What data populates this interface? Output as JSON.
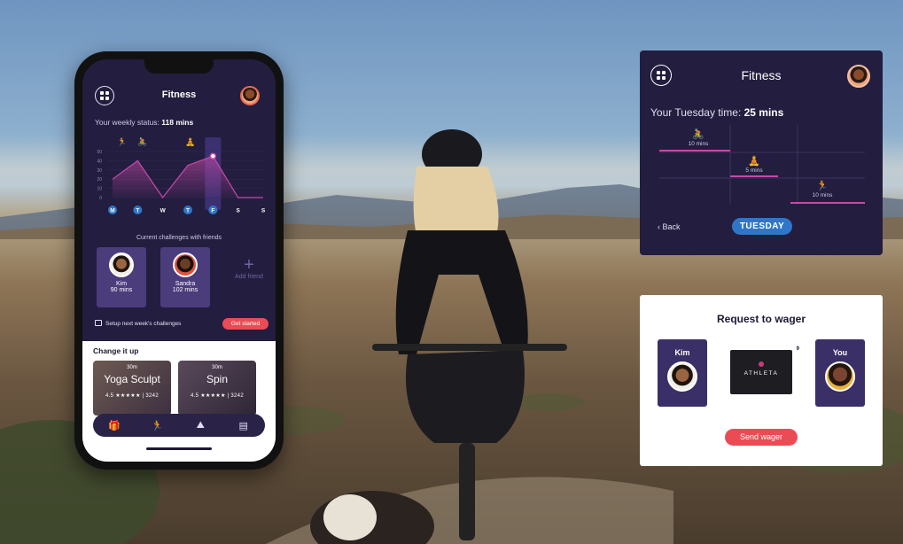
{
  "phone": {
    "title": "Fitness",
    "status_prefix": "Your weekly status: ",
    "status_value": "118 mins",
    "chart_data": {
      "type": "area",
      "categories": [
        "M",
        "T",
        "W",
        "T",
        "F",
        "S",
        "S"
      ],
      "values": [
        20,
        40,
        0,
        35,
        45,
        0,
        0
      ],
      "yticks": [
        "50",
        "40",
        "30",
        "20",
        "10",
        "0"
      ],
      "ylim": [
        0,
        50
      ],
      "highlighted_day": "F",
      "completed_days": [
        "M",
        "T",
        "T",
        "F"
      ]
    },
    "challenges_title": "Current challenges with friends",
    "friends": [
      {
        "name": "Kim",
        "value": "90 mins"
      },
      {
        "name": "Sandra",
        "value": "102 mins"
      }
    ],
    "add_friend_label": "Add friend",
    "setup_label": "Setup next week's challenges",
    "get_started_label": "Get started",
    "change_title": "Change it up",
    "classes": [
      {
        "duration": "30m",
        "name": "Yoga Sculpt",
        "rating": "4.5 ★★★★★ | 3242"
      },
      {
        "duration": "30m",
        "name": "Spin",
        "rating": "4.5 ★★★★★ | 3242"
      }
    ]
  },
  "tuesday": {
    "title": "Fitness",
    "status_prefix": "Your Tuesday time: ",
    "status_value": "25 mins",
    "activities": [
      {
        "label": "10 mins",
        "icon": "bike-icon"
      },
      {
        "label": "5 mins",
        "icon": "meditation-icon"
      },
      {
        "label": "10 mins",
        "icon": "run-icon"
      }
    ],
    "back_label": "‹ Back",
    "day_label": "TUESDAY"
  },
  "wager": {
    "title": "Request to wager",
    "left_name": "Kim",
    "right_name": "You",
    "brand": "ATHLETA",
    "brand_count": "9",
    "send_label": "Send wager"
  },
  "colors": {
    "panel_dark": "#231d3f",
    "card_purple": "#4b3c7c",
    "accent_red": "#ea4c55",
    "accent_blue": "#2f76c9",
    "line_pink": "#c64aa9"
  }
}
